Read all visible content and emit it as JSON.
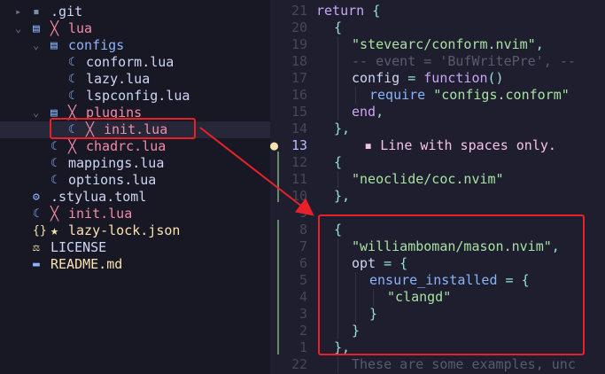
{
  "tree": {
    "items": [
      {
        "chevron": "▸",
        "icon": "▪",
        "name": ".git",
        "mark": "",
        "icon_color": "#7f8ba8",
        "name_color": "#cdd6f4"
      },
      {
        "chevron": "⌄",
        "icon": "▤",
        "name": "lua",
        "mark": "╳",
        "icon_color": "#89b4fa",
        "name_color": "#f38ba8"
      },
      {
        "chevron": "⌄",
        "icon": "▤",
        "name": "configs",
        "mark": "",
        "icon_color": "#89b4fa",
        "name_color": "#89b4fa"
      },
      {
        "chevron": "",
        "icon": "☾",
        "name": "conform.lua",
        "mark": "",
        "icon_color": "#89b4fa",
        "name_color": "#cdd6f4"
      },
      {
        "chevron": "",
        "icon": "☾",
        "name": "lazy.lua",
        "mark": "",
        "icon_color": "#89b4fa",
        "name_color": "#cdd6f4"
      },
      {
        "chevron": "",
        "icon": "☾",
        "name": "lspconfig.lua",
        "mark": "",
        "icon_color": "#89b4fa",
        "name_color": "#cdd6f4"
      },
      {
        "chevron": "⌄",
        "icon": "▤",
        "name": "plugins",
        "mark": "╳",
        "icon_color": "#89b4fa",
        "name_color": "#f38ba8"
      },
      {
        "chevron": "",
        "icon": "☾",
        "name": "init.lua",
        "mark": "╳",
        "icon_color": "#89b4fa",
        "name_color": "#f38ba8"
      },
      {
        "chevron": "",
        "icon": "☾",
        "name": "chadrc.lua",
        "mark": "╳",
        "icon_color": "#89b4fa",
        "name_color": "#f38ba8"
      },
      {
        "chevron": "",
        "icon": "☾",
        "name": "mappings.lua",
        "mark": "",
        "icon_color": "#89b4fa",
        "name_color": "#cdd6f4"
      },
      {
        "chevron": "",
        "icon": "☾",
        "name": "options.lua",
        "mark": "",
        "icon_color": "#89b4fa",
        "name_color": "#cdd6f4"
      },
      {
        "chevron": "",
        "icon": "⚙",
        "name": ".stylua.toml",
        "mark": "",
        "icon_color": "#89b4fa",
        "name_color": "#cdd6f4"
      },
      {
        "chevron": "",
        "icon": "☾",
        "name": "init.lua",
        "mark": "╳",
        "icon_color": "#89b4fa",
        "name_color": "#f38ba8"
      },
      {
        "chevron": "",
        "icon": "{}",
        "name": "lazy-lock.json",
        "mark": "★",
        "icon_color": "#f9e2af",
        "name_color": "#f9e2af"
      },
      {
        "chevron": "",
        "icon": "⚖",
        "name": "LICENSE",
        "mark": "",
        "icon_color": "#f9e2af",
        "name_color": "#cdd6f4"
      },
      {
        "chevron": "",
        "icon": "▬",
        "name": "README.md",
        "mark": "",
        "icon_color": "#89b4fa",
        "name_color": "#f9e2af"
      }
    ]
  },
  "editor": {
    "lines": [
      {
        "num": "21",
        "indent": 0,
        "tokens": [
          [
            "kw",
            "return"
          ],
          [
            "var",
            " "
          ],
          [
            "punc",
            "{"
          ]
        ]
      },
      {
        "num": "20",
        "indent": 1,
        "tokens": [
          [
            "punc",
            "{"
          ]
        ]
      },
      {
        "num": "19",
        "indent": 2,
        "tokens": [
          [
            "str",
            "\"stevearc/conform.nvim\""
          ],
          [
            "punc",
            ","
          ]
        ]
      },
      {
        "num": "18",
        "indent": 2,
        "tokens": [
          [
            "com",
            "-- event = 'BufWritePre', --"
          ]
        ]
      },
      {
        "num": "17",
        "indent": 2,
        "tokens": [
          [
            "var",
            "config "
          ],
          [
            "punc",
            "= "
          ],
          [
            "kw",
            "function"
          ],
          [
            "punc",
            "()"
          ]
        ]
      },
      {
        "num": "16",
        "indent": 3,
        "tokens": [
          [
            "fn",
            "require "
          ],
          [
            "str",
            "\"configs.conform\""
          ]
        ]
      },
      {
        "num": "15",
        "indent": 2,
        "tokens": [
          [
            "kw",
            "end"
          ],
          [
            "punc",
            ","
          ]
        ]
      },
      {
        "num": "14",
        "indent": 1,
        "tokens": [
          [
            "punc",
            "},"
          ]
        ]
      },
      {
        "num": "13",
        "indent": 0,
        "tokens": [
          [
            "virt",
            "      ▪ Line with spaces only."
          ]
        ]
      },
      {
        "num": "12",
        "indent": 1,
        "tokens": [
          [
            "punc",
            "{"
          ]
        ]
      },
      {
        "num": "11",
        "indent": 2,
        "tokens": [
          [
            "str",
            "\"neoclide/coc.nvim\""
          ]
        ]
      },
      {
        "num": "10",
        "indent": 1,
        "tokens": [
          [
            "punc",
            "},"
          ]
        ]
      },
      {
        "num": "9",
        "indent": 0,
        "tokens": []
      },
      {
        "num": "8",
        "indent": 1,
        "tokens": [
          [
            "punc",
            "{"
          ]
        ]
      },
      {
        "num": "7",
        "indent": 2,
        "tokens": [
          [
            "str",
            "\"williamboman/mason.nvim\""
          ],
          [
            "punc",
            ","
          ]
        ]
      },
      {
        "num": "6",
        "indent": 2,
        "tokens": [
          [
            "var",
            "opt "
          ],
          [
            "punc",
            "= {"
          ]
        ]
      },
      {
        "num": "5",
        "indent": 3,
        "tokens": [
          [
            "field",
            "ensure_installed "
          ],
          [
            "punc",
            "= {"
          ]
        ]
      },
      {
        "num": "4",
        "indent": 4,
        "tokens": [
          [
            "str",
            "\"clangd\""
          ]
        ]
      },
      {
        "num": "3",
        "indent": 3,
        "tokens": [
          [
            "punc",
            "}"
          ]
        ]
      },
      {
        "num": "2",
        "indent": 2,
        "tokens": [
          [
            "punc",
            "}"
          ]
        ]
      },
      {
        "num": "1",
        "indent": 1,
        "tokens": [
          [
            "punc",
            "},"
          ]
        ]
      },
      {
        "num": "22",
        "indent": 2,
        "tokens": [
          [
            "com",
            "These are some examples, unc"
          ]
        ]
      }
    ],
    "current_line": "13",
    "lightbulb_icon": "lightbulb-icon"
  },
  "colors": {
    "annotation": "#e8202a",
    "git_added": "#a6e3a1"
  }
}
